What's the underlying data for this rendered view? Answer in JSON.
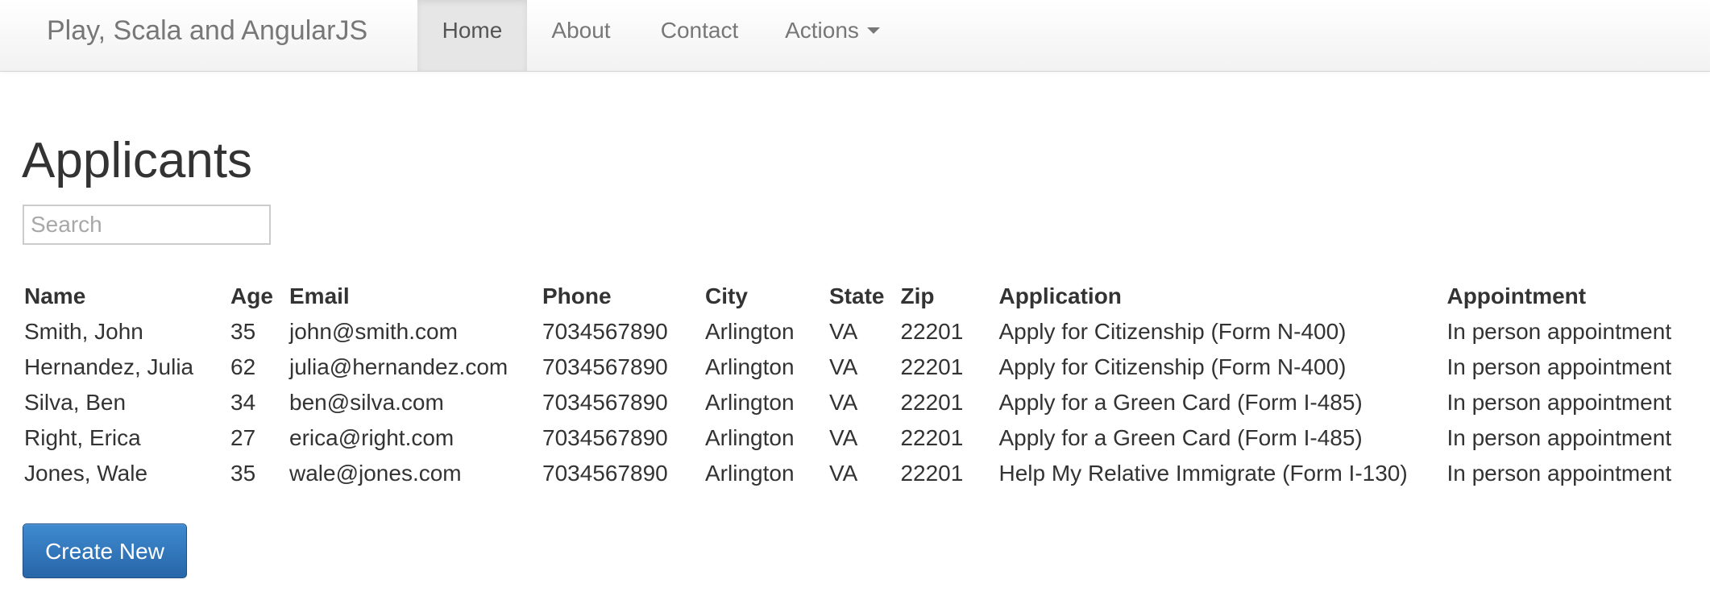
{
  "navbar": {
    "brand": "Play, Scala and AngularJS",
    "items": [
      {
        "label": "Home",
        "active": true
      },
      {
        "label": "About"
      },
      {
        "label": "Contact"
      },
      {
        "label": "Actions",
        "dropdown": true
      }
    ]
  },
  "page": {
    "title": "Applicants",
    "search_placeholder": "Search"
  },
  "table": {
    "headers": [
      "Name",
      "Age",
      "Email",
      "Phone",
      "City",
      "State",
      "Zip",
      "Application",
      "Appointment"
    ],
    "rows": [
      [
        "Smith, John",
        "35",
        "john@smith.com",
        "7034567890",
        "Arlington",
        "VA",
        "22201",
        "Apply for Citizenship (Form N-400)",
        "In person appointment"
      ],
      [
        "Hernandez, Julia",
        "62",
        "julia@hernandez.com",
        "7034567890",
        "Arlington",
        "VA",
        "22201",
        "Apply for Citizenship (Form N-400)",
        "In person appointment"
      ],
      [
        "Silva, Ben",
        "34",
        "ben@silva.com",
        "7034567890",
        "Arlington",
        "VA",
        "22201",
        "Apply for a Green Card (Form I-485)",
        "In person appointment"
      ],
      [
        "Right, Erica",
        "27",
        "erica@right.com",
        "7034567890",
        "Arlington",
        "VA",
        "22201",
        "Apply for a Green Card (Form I-485)",
        "In person appointment"
      ],
      [
        "Jones, Wale",
        "35",
        "wale@jones.com",
        "7034567890",
        "Arlington",
        "VA",
        "22201",
        "Help My Relative Immigrate (Form I-130)",
        "In person appointment"
      ]
    ]
  },
  "actions": {
    "create_label": "Create New"
  },
  "colors": {
    "navbar_bg": "#f8f8f8",
    "active_tab_bg": "#e6e6e6",
    "primary_button": "#2f7bc4",
    "text": "#333333",
    "nav_text": "#777777"
  },
  "icons": {
    "dropdown": "caret-down-icon"
  }
}
